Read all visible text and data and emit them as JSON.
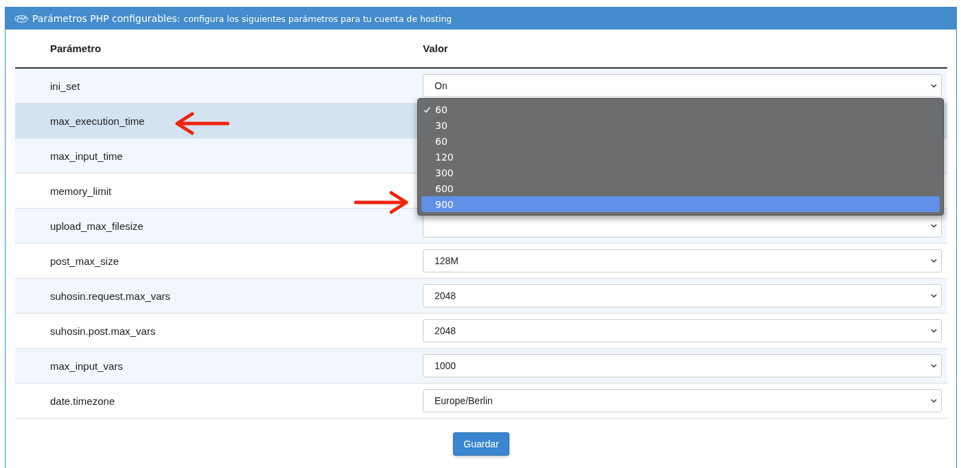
{
  "panel": {
    "title": "Parámetros PHP configurables:",
    "subtitle": "configura los siguientes parámetros para tu cuenta de hosting"
  },
  "table": {
    "columns": [
      "Parámetro",
      "Valor"
    ],
    "rows": [
      {
        "name": "ini_set",
        "value": "On",
        "highlighted": false,
        "arrow": false
      },
      {
        "name": "max_execution_time",
        "highlighted": true,
        "arrow": true,
        "dropdown": {
          "options": [
            {
              "label": "60",
              "checked": true,
              "selected": false,
              "arrow": false
            },
            {
              "label": "30",
              "checked": false,
              "selected": false,
              "arrow": false
            },
            {
              "label": "60",
              "checked": false,
              "selected": false,
              "arrow": false
            },
            {
              "label": "120",
              "checked": false,
              "selected": false,
              "arrow": false
            },
            {
              "label": "300",
              "checked": false,
              "selected": false,
              "arrow": false
            },
            {
              "label": "600",
              "checked": false,
              "selected": false,
              "arrow": false
            },
            {
              "label": "900",
              "checked": false,
              "selected": true,
              "arrow": true
            }
          ]
        }
      },
      {
        "name": "max_input_time",
        "highlighted": false,
        "arrow": false
      },
      {
        "name": "memory_limit",
        "highlighted": false,
        "arrow": false
      },
      {
        "name": "upload_max_filesize",
        "highlighted": false,
        "arrow": false
      },
      {
        "name": "post_max_size",
        "value": "128M",
        "highlighted": false,
        "arrow": false
      },
      {
        "name": "suhosin.request.max_vars",
        "value": "2048",
        "highlighted": false,
        "arrow": false
      },
      {
        "name": "suhosin.post.max_vars",
        "value": "2048",
        "highlighted": false,
        "arrow": false
      },
      {
        "name": "max_input_vars",
        "value": "1000",
        "highlighted": false,
        "arrow": false
      },
      {
        "name": "date.timezone",
        "value": "Europe/Berlin",
        "highlighted": false,
        "arrow": false
      }
    ]
  },
  "button": "Guardar"
}
